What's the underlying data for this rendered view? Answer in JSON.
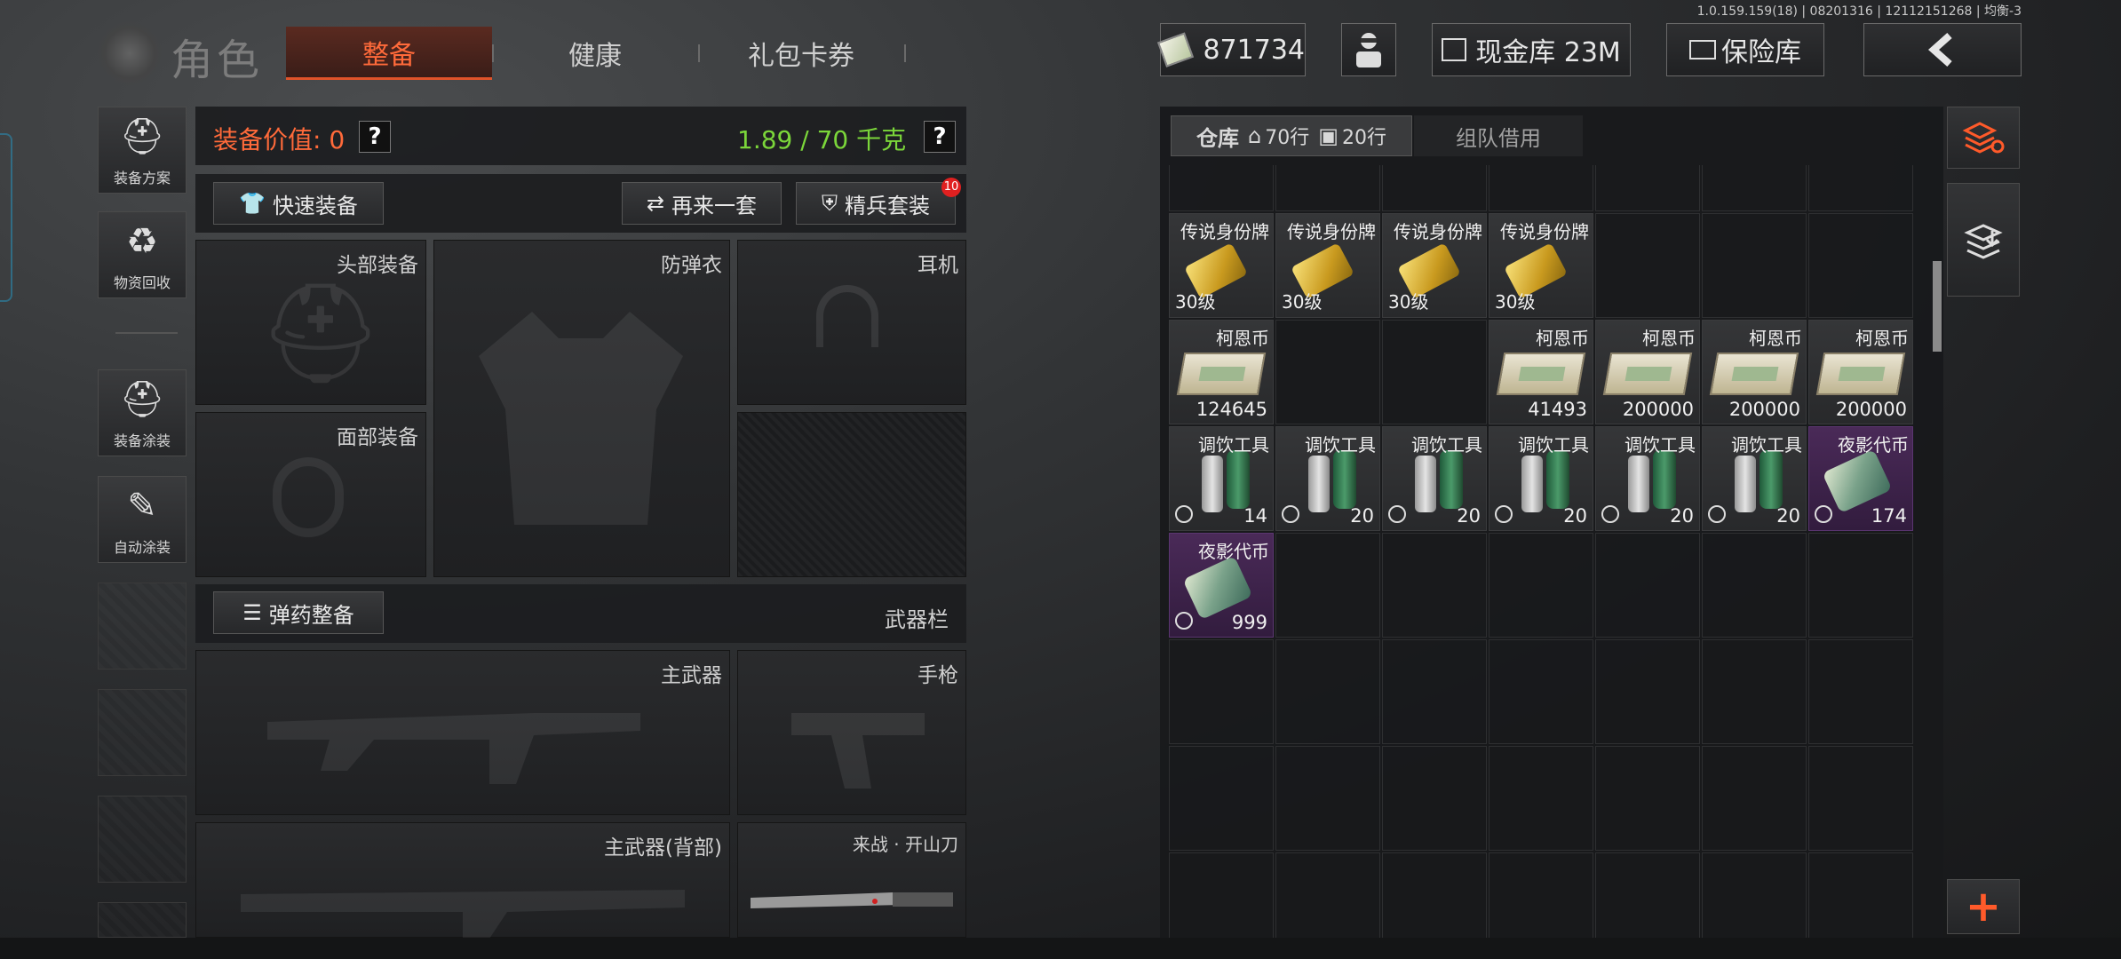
{
  "version": "1.0.159.159(18) | 08201316 | 12112151268 | 均衡-3",
  "header": {
    "title": "角色",
    "tabs": [
      {
        "label": "整备",
        "active": true
      },
      {
        "label": "健康",
        "active": false
      },
      {
        "label": "礼包卡券",
        "active": false
      }
    ],
    "currency": "871734",
    "cash_vault": "现金库 23M",
    "safe": "保险库"
  },
  "nav": [
    {
      "label": "装备方案",
      "icon": "equipment-plan-icon"
    },
    {
      "label": "物资回收",
      "icon": "recycle-icon"
    },
    {
      "label": "装备涂装",
      "icon": "paint-icon"
    },
    {
      "label": "自动涂装",
      "icon": "auto-paint-icon"
    }
  ],
  "equip": {
    "value_label": "装备价值: 0",
    "weight": "1.89 / 70 千克",
    "help": "?",
    "quick_equip": "快速装备",
    "again": "再来一套",
    "elite": "精兵套装",
    "elite_badge": "10",
    "ammo": "弹药整备",
    "weapon_bar": "武器栏",
    "slots": {
      "head": "头部装备",
      "armor": "防弹衣",
      "headset": "耳机",
      "face": "面部装备",
      "primary": "主武器",
      "pistol": "手枪",
      "primary_back": "主武器(背部)",
      "melee": "来战 · 开山刀"
    }
  },
  "warehouse": {
    "tab_label": "仓库",
    "rows_home": "70行",
    "rows_bag": "20行",
    "team_borrow": "组队借用",
    "items": [
      {
        "name": "传说身份牌",
        "level": "30级",
        "type": "tag",
        "row": 0,
        "col": 0
      },
      {
        "name": "传说身份牌",
        "level": "30级",
        "type": "tag",
        "row": 0,
        "col": 1
      },
      {
        "name": "传说身份牌",
        "level": "30级",
        "type": "tag",
        "row": 0,
        "col": 2
      },
      {
        "name": "传说身份牌",
        "level": "30级",
        "type": "tag",
        "row": 0,
        "col": 3
      },
      {
        "name": "柯恩币",
        "count": "124645",
        "type": "cash",
        "row": 1,
        "col": 0
      },
      {
        "name": "柯恩币",
        "count": "41493",
        "type": "cash",
        "row": 1,
        "col": 3
      },
      {
        "name": "柯恩币",
        "count": "200000",
        "type": "cash",
        "row": 1,
        "col": 4
      },
      {
        "name": "柯恩币",
        "count": "200000",
        "type": "cash",
        "row": 1,
        "col": 5
      },
      {
        "name": "柯恩币",
        "count": "200000",
        "type": "cash",
        "row": 1,
        "col": 6
      },
      {
        "name": "调饮工具",
        "count": "14",
        "type": "bottle",
        "row": 2,
        "col": 0
      },
      {
        "name": "调饮工具",
        "count": "20",
        "type": "bottle",
        "row": 2,
        "col": 1
      },
      {
        "name": "调饮工具",
        "count": "20",
        "type": "bottle",
        "row": 2,
        "col": 2
      },
      {
        "name": "调饮工具",
        "count": "20",
        "type": "bottle",
        "row": 2,
        "col": 3
      },
      {
        "name": "调饮工具",
        "count": "20",
        "type": "bottle",
        "row": 2,
        "col": 4
      },
      {
        "name": "调饮工具",
        "count": "20",
        "type": "bottle",
        "row": 2,
        "col": 5
      },
      {
        "name": "夜影代币",
        "count": "174",
        "type": "token",
        "row": 2,
        "col": 6
      },
      {
        "name": "夜影代币",
        "count": "999",
        "type": "token",
        "row": 3,
        "col": 0
      }
    ],
    "add": "+"
  }
}
